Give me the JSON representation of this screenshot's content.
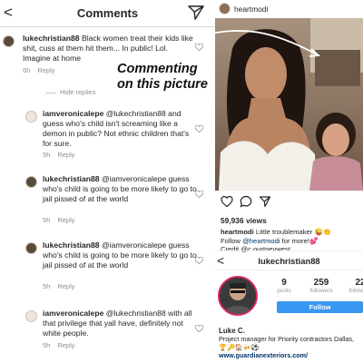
{
  "comments_panel": {
    "title": "Comments",
    "hide_replies": "Hide replies",
    "comments": [
      {
        "user": "lukechristian88",
        "text": "Black women treat their kids like shit, cuss at them hit them... In public! Lol. Imagine at home",
        "time": "6h",
        "reply": "Reply"
      },
      {
        "user": "iamveronicalepe",
        "text": "@lukechristian88 and guess who's child isn't screaming like a demon in public? Not ethnic children that's for sure.",
        "time": "5h",
        "reply": "Reply"
      },
      {
        "user": "lukechristian88",
        "text": "@iamveronicalepe guess who's child is going to be more likely to go to jail pissed of at the world",
        "time": "5h",
        "reply": "Reply"
      },
      {
        "user": "lukechristian88",
        "text": "@iamveronicalepe guess who's child is going to be more likely to go to jail pissed of at the world",
        "time": "5h",
        "reply": "Reply"
      },
      {
        "user": "iamveronicalepe",
        "text": "@lukechristian88 with all that privilege that yall have, definitely not white people.",
        "time": "5h",
        "reply": "Reply"
      }
    ]
  },
  "annotation": {
    "line1": "Commenting",
    "line2": "on this picture"
  },
  "post": {
    "username": "heartmodi",
    "slide_count": "2",
    "views": "59,936 views",
    "caption_user": "heartmodi",
    "caption_text": "Little troublemaker",
    "caption_emoji": "😜👏",
    "follow_line_prefix": "Follow ",
    "follow_line_link": "@heartmodi",
    "follow_line_suffix": " for more!",
    "follow_line_emoji": "💕",
    "credit": "Credit @c.ourtnevwest"
  },
  "profile": {
    "username": "lukechristian88",
    "posts_count": "9",
    "posts_label": "posts",
    "followers_count": "259",
    "followers_label": "followers",
    "following_count": "22",
    "following_label": "following",
    "follow_button": "Follow",
    "bio_name": "Luke C.",
    "bio_text": "Project manager for Priority contractors Dallas,",
    "bio_emoji": "🏆🔑🏠🍻⚽",
    "bio_link": "www.guardianexteriors.com/"
  },
  "colors": {
    "accent_blue": "#3897f0",
    "text_gray": "#8e8e8e",
    "story_ring": "#e0246a"
  }
}
